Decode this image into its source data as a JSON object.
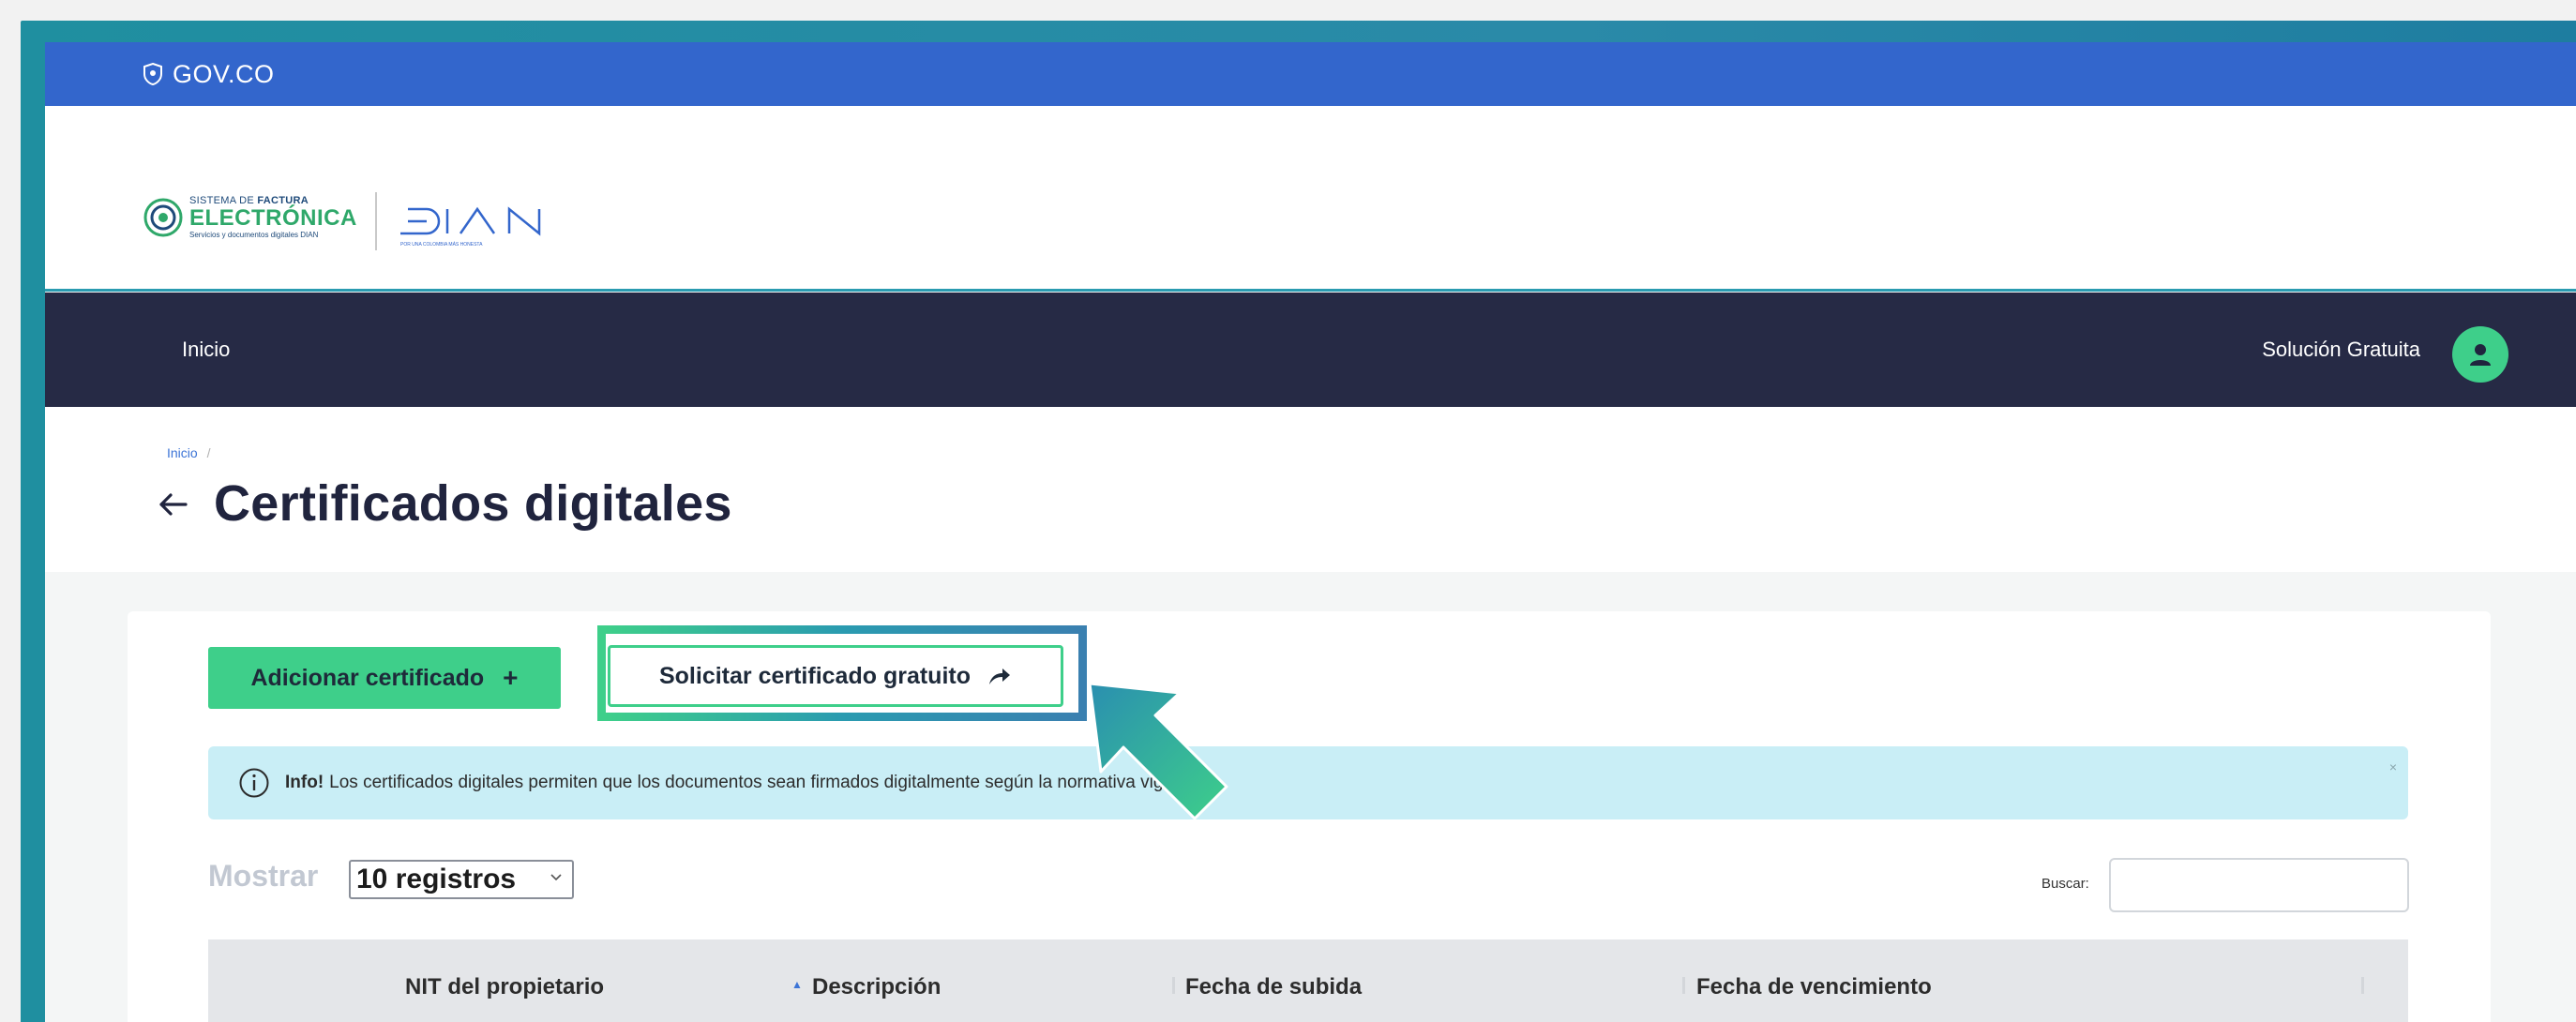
{
  "gov": {
    "label": "GOV.CO"
  },
  "brand": {
    "sfe_line1_prefix": "SISTEMA DE ",
    "sfe_line1_bold": "FACTURA",
    "sfe_line2": "ELECTRÓNICA",
    "sfe_line3": "Servicios y documentos digitales DIAN",
    "dian_tagline": "POR UNA COLOMBIA MÁS HONESTA"
  },
  "nav": {
    "home": "Inicio",
    "solution": "Solución Gratuita"
  },
  "breadcrumb": {
    "home": "Inicio",
    "sep": "/"
  },
  "page": {
    "title": "Certificados digitales"
  },
  "actions": {
    "add_label": "Adicionar certificado",
    "add_icon": "+",
    "request_label": "Solicitar certificado gratuito"
  },
  "info": {
    "strong": "Info!",
    "text": "Los certificados digitales permiten que los documentos sean firmados digitalmente según la normativa vigente.",
    "close": "×"
  },
  "table_controls": {
    "show_label": "Mostrar",
    "page_size": "10 registros",
    "search_label": "Buscar:",
    "search_value": ""
  },
  "table": {
    "columns": [
      "NIT del propietario",
      "Descripción",
      "Fecha de subida",
      "Fecha de vencimiento"
    ]
  },
  "colors": {
    "gov_blue": "#3366cc",
    "nav_dark": "#262a45",
    "accent_green": "#3ecf8a",
    "info_bg": "#c9eef6"
  }
}
